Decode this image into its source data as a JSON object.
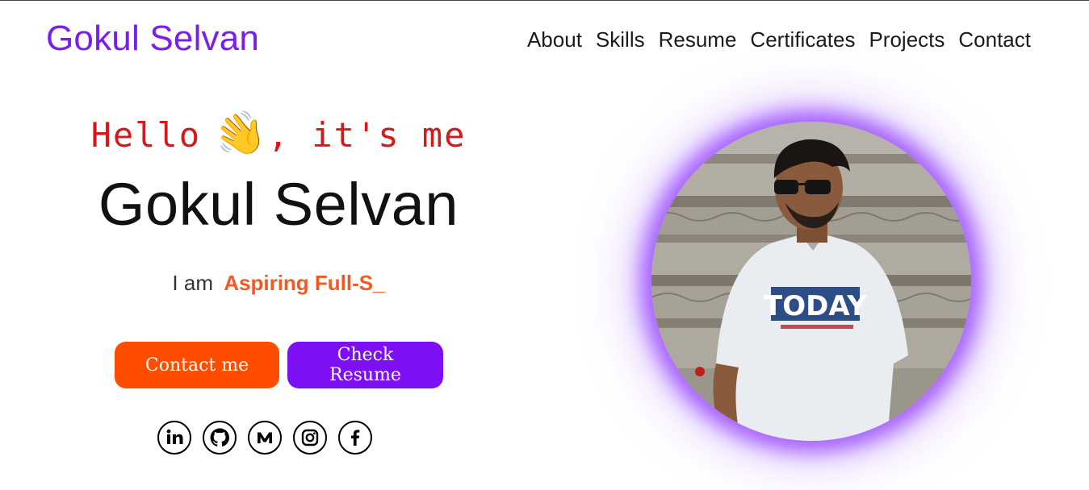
{
  "header": {
    "brand": "Gokul Selvan",
    "nav": [
      "About",
      "Skills",
      "Resume",
      "Certificates",
      "Projects",
      "Contact"
    ]
  },
  "hero": {
    "greeting_before": "Hello",
    "greeting_emoji": "👋",
    "greeting_after": ", it's me",
    "name": "Gokul Selvan",
    "tagline_intro": "I am",
    "tagline_role": "Aspiring Full-S_",
    "buttons": {
      "contact": "Contact me",
      "resume": "Check Resume"
    },
    "socials": [
      "linkedin-icon",
      "github-icon",
      "medium-icon",
      "instagram-icon",
      "facebook-icon"
    ],
    "photo_shirt_text": "TODAY"
  },
  "colors": {
    "brand": "#7a1ef0",
    "greeting": "#d81818",
    "role": "#f25a25",
    "contact_button": "#ff4d00",
    "resume_button": "#7d0ff5",
    "photo_glow": "#923aff"
  }
}
